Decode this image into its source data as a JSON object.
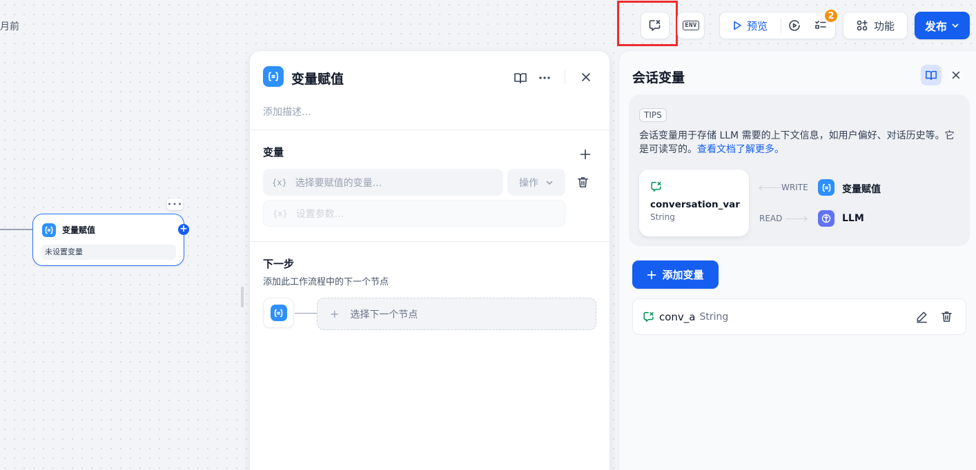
{
  "top_left_text": "月前",
  "toolbar": {
    "env_label": "ENV",
    "preview_label": "预览",
    "checklist_badge": "2",
    "features_label": "功能",
    "publish_label": "发布"
  },
  "canvas_node": {
    "title": "变量赋值",
    "subtitle": "未设置变量",
    "more": "•••",
    "plus": "+"
  },
  "node_panel": {
    "title": "变量赋值",
    "description_placeholder": "添加描述...",
    "variables_title": "变量",
    "select_var_placeholder": "选择要赋值的变量...",
    "operation_placeholder": "操作",
    "param_placeholder": "设置参数...",
    "fx": "{x}",
    "next_step_title": "下一步",
    "next_step_subtitle": "添加此工作流程中的下一个节点",
    "select_next_node": "选择下一个节点",
    "plus": "+"
  },
  "conv_panel": {
    "title": "会话变量",
    "tips_tag": "TIPS",
    "tips_text": "会话变量用于存储 LLM 需要的上下文信息，如用户偏好、对话历史等。它是可读写的。",
    "tips_link": "查看文档了解更多。",
    "var_card": {
      "name": "conversation_var",
      "type": "String"
    },
    "flow": {
      "write_label": "WRITE",
      "write_target": "变量赋值",
      "read_label": "READ",
      "read_target": "LLM"
    },
    "add_button": "添加变量",
    "variables": [
      {
        "name": "conv_a",
        "type": "String"
      }
    ]
  },
  "colors": {
    "accent": "#155eef",
    "node_icon": "#2e90fa",
    "llm_icon": "#6172f3",
    "badge": "#f79009",
    "highlight": "#ef2b2b",
    "conv_icon": "#079455"
  }
}
